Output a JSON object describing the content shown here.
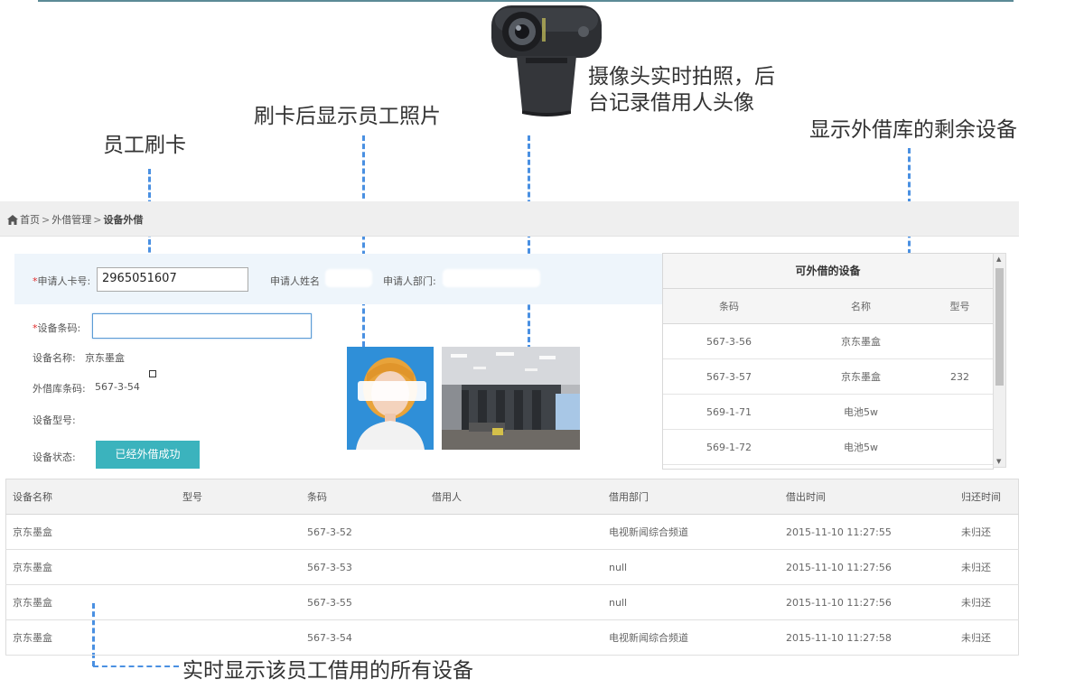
{
  "annotations": {
    "swipe": "员工刷卡",
    "photo": "刷卡后显示员工照片",
    "camera_line1": "摄像头实时拍照，后",
    "camera_line2": "台记录借用人头像",
    "remaining": "显示外借库的剩余设备",
    "all_devices": "实时显示该员工借用的所有设备"
  },
  "breadcrumb": {
    "home": "首页",
    "sep": ">",
    "level2": "外借管理",
    "current": "设备外借"
  },
  "form": {
    "card_label": "申请人卡号:",
    "card_value": "2965051607",
    "name_label": "申请人姓名",
    "dept_label": "申请人部门:",
    "barcode_label": "设备条码:",
    "barcode_value": "",
    "device_name_label": "设备名称:",
    "device_name_value": "京东墨盒",
    "loan_barcode_label": "外借库条码:",
    "loan_barcode_value": "567-3-54",
    "model_label": "设备型号:",
    "model_value": "",
    "status_label": "设备状态:",
    "status_button": "已经外借成功"
  },
  "available": {
    "title": "可外借的设备",
    "columns": [
      "条码",
      "名称",
      "型号"
    ],
    "rows": [
      [
        "567-3-56",
        "京东墨盒",
        ""
      ],
      [
        "567-3-57",
        "京东墨盒",
        "232"
      ],
      [
        "569-1-71",
        "电池5w",
        ""
      ],
      [
        "569-1-72",
        "电池5w",
        ""
      ]
    ]
  },
  "borrowed": {
    "columns": [
      "设备名称",
      "型号",
      "条码",
      "借用人",
      "借用部门",
      "借出时间",
      "归还时间"
    ],
    "rows": [
      [
        "京东墨盒",
        "",
        "567-3-52",
        "",
        "电视新闻综合频道",
        "2015-11-10 11:27:55",
        "未归还"
      ],
      [
        "京东墨盒",
        "",
        "567-3-53",
        "",
        "null",
        "2015-11-10 11:27:56",
        "未归还"
      ],
      [
        "京东墨盒",
        "",
        "567-3-55",
        "",
        "null",
        "2015-11-10 11:27:56",
        "未归还"
      ],
      [
        "京东墨盒",
        "",
        "567-3-54",
        "",
        "电视新闻综合频道",
        "2015-11-10 11:27:58",
        "未归还"
      ]
    ]
  },
  "colors": {
    "accent": "#3bb3bd",
    "annotation_line": "#4a90e2",
    "required": "#e02a2a"
  },
  "icons": {
    "home": "home-icon",
    "camera": "webcam-icon",
    "scroll_up": "scroll-up-icon",
    "scroll_down": "scroll-down-icon"
  }
}
